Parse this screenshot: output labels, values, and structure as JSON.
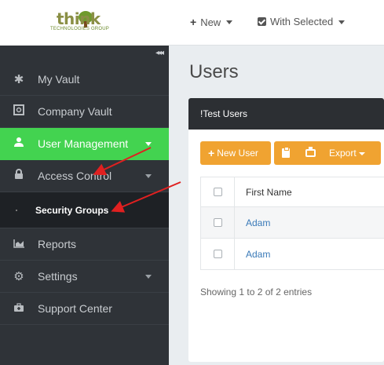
{
  "logo": {
    "word": "think",
    "tagline": "TECHNOLOGIES GROUP"
  },
  "header": {
    "new_label": "New",
    "with_selected_label": "With Selected"
  },
  "sidebar": {
    "collapse_glyph": "◂◂◂",
    "items": [
      {
        "label": "My Vault",
        "icon": "asterisk-icon"
      },
      {
        "label": "Company Vault",
        "icon": "safe-icon"
      },
      {
        "label": "User Management",
        "icon": "user-icon",
        "active": true
      },
      {
        "label": "Access Control",
        "icon": "lock-icon"
      },
      {
        "label": "Security Groups",
        "sub": true
      },
      {
        "label": "Reports",
        "icon": "area-chart-icon"
      },
      {
        "label": "Settings",
        "icon": "gears-icon"
      },
      {
        "label": "Support Center",
        "icon": "medkit-icon"
      }
    ]
  },
  "main": {
    "title": "Users",
    "panel_title": "!Test Users",
    "toolbar": {
      "new_user_label": "New User",
      "export_label": "Export"
    },
    "table": {
      "header": "First Name",
      "rows": [
        "Adam",
        "Adam"
      ]
    },
    "footer": "Showing 1 to 2 of 2 entries"
  },
  "colors": {
    "accent_green": "#43d350",
    "button_orange": "#f0a331",
    "sidebar_dark": "#2f3338",
    "annotation_red": "#e02020"
  }
}
